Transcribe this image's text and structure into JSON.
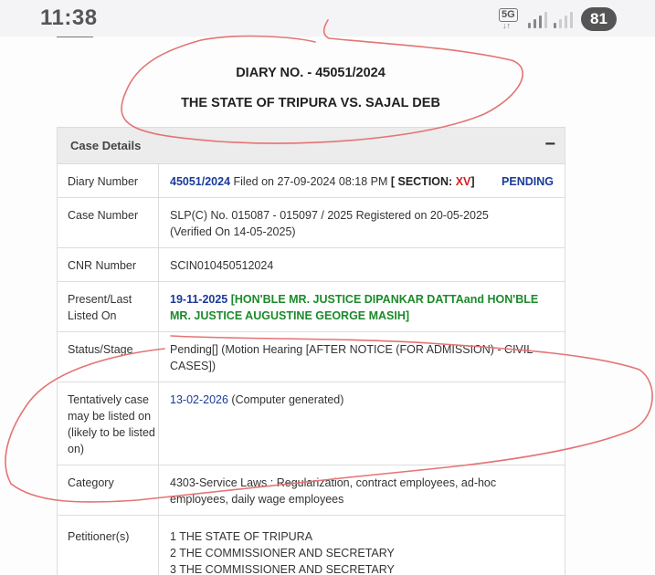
{
  "status_bar": {
    "time": "11:38",
    "network": "5G",
    "network_arrows": "↓↑",
    "battery": "81"
  },
  "page": {
    "diary_heading": "DIARY NO. - 45051/2024",
    "parties_heading": "THE STATE OF TRIPURA VS. SAJAL DEB"
  },
  "case_details": {
    "section_title": "Case Details",
    "collapse_symbol": "−",
    "diary_number": {
      "label": "Diary Number",
      "number": "45051/2024",
      "filed_text": " Filed on 27-09-2024 08:18 PM ",
      "section_open": "[ SECTION: ",
      "section_value": "XV",
      "section_close": "]",
      "status": "PENDING"
    },
    "case_number": {
      "label": "Case Number",
      "value": "SLP(C) No. 015087 - 015097 / 2025 Registered on 20-05-2025",
      "verified": "(Verified On 14-05-2025)"
    },
    "cnr_number": {
      "label": "CNR Number",
      "value": "SCIN010450512024"
    },
    "present_last": {
      "label": "Present/Last Listed On",
      "date": "19-11-2025",
      "bench": " [HON'BLE MR. JUSTICE DIPANKAR DATTAand HON'BLE MR. JUSTICE AUGUSTINE GEORGE MASIH]"
    },
    "status_stage": {
      "label": "Status/Stage",
      "value": "Pending[] (Motion Hearing [AFTER NOTICE (FOR ADMISSION) - CIVIL CASES])"
    },
    "tentative": {
      "label": "Tentatively case may be listed on (likely to be listed on)",
      "date": "13-02-2026",
      "note": " (Computer generated)"
    },
    "category": {
      "label": "Category",
      "value": "4303-Service Laws : Regularization, contract employees, ad-hoc employees, daily wage employees"
    },
    "petitioners": {
      "label": "Petitioner(s)",
      "items": [
        "1 THE STATE OF TRIPURA",
        "2 THE COMMISSIONER AND SECRETARY",
        "3 THE COMMISSIONER AND SECRETARY"
      ]
    }
  },
  "colors": {
    "annotation_stroke": "#e57373",
    "link_blue": "#1a3a9a",
    "pending_red": "#c62828",
    "bench_green": "#1b8a2a"
  }
}
